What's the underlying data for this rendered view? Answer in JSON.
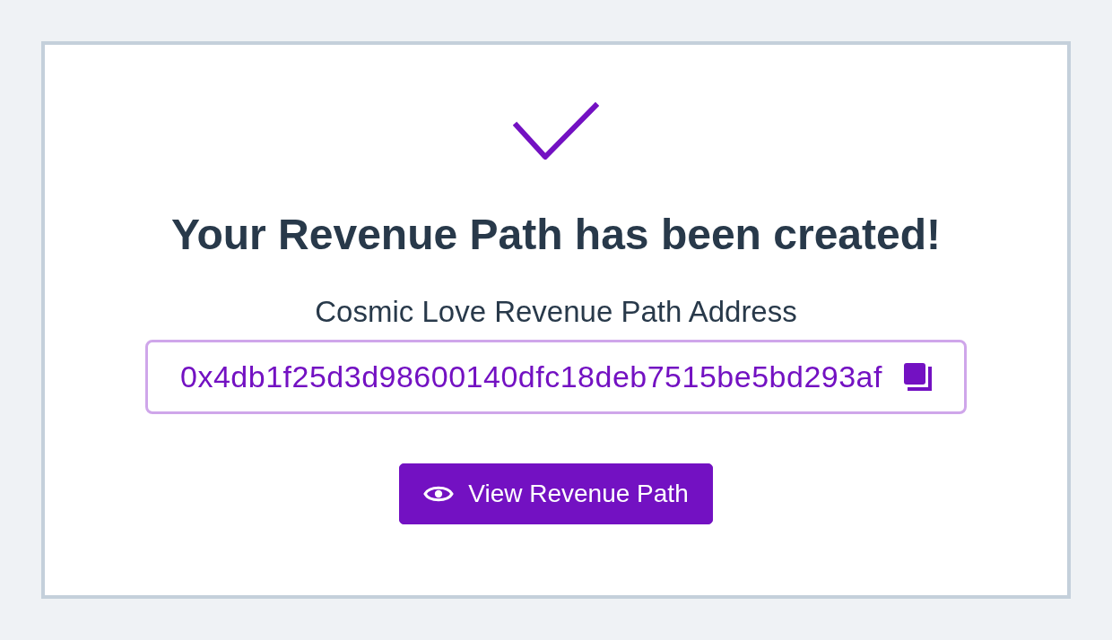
{
  "success": {
    "heading": "Your Revenue Path has been created!"
  },
  "address": {
    "label": "Cosmic Love Revenue Path Address",
    "value": "0x4db1f25d3d98600140dfc18deb7515be5bd293af"
  },
  "buttons": [
    {
      "label": "View Revenue Path"
    }
  ]
}
